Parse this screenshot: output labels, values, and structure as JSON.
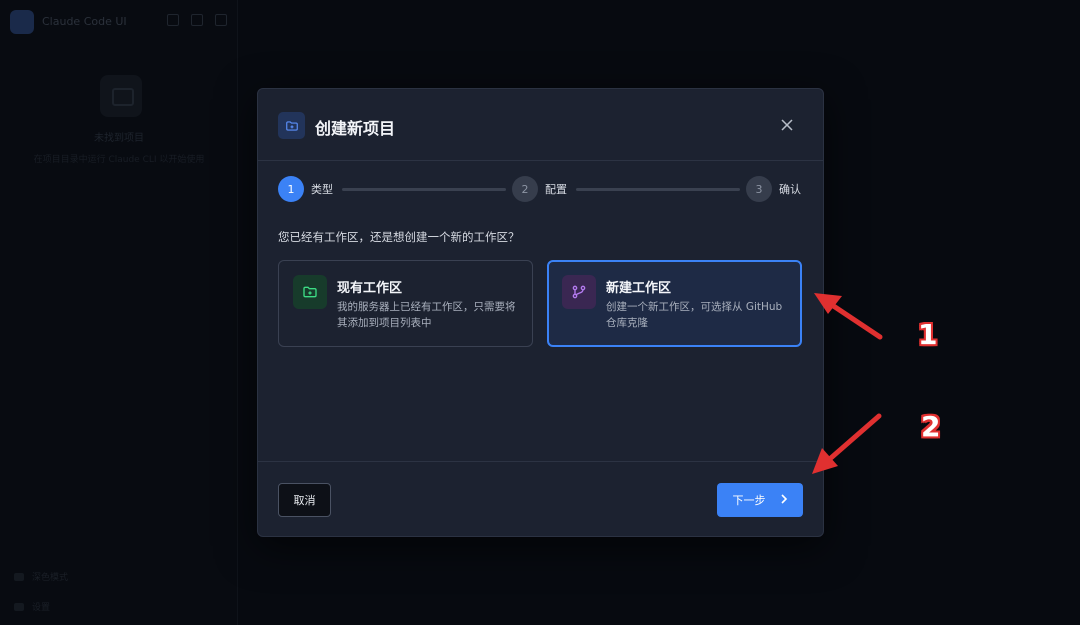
{
  "background_app": {
    "title": "Claude Code UI",
    "empty_title": "未找到项目",
    "empty_desc": "在项目目录中运行 Claude CLI 以开始使用",
    "footer_items": [
      "深色模式",
      "设置"
    ]
  },
  "modal": {
    "title": "创建新项目",
    "steps": [
      {
        "number": "1",
        "label": "类型",
        "state": "active"
      },
      {
        "number": "2",
        "label": "配置",
        "state": "idle"
      },
      {
        "number": "3",
        "label": "确认",
        "state": "idle"
      }
    ],
    "question": "您已经有工作区，还是想创建一个新的工作区？",
    "options": [
      {
        "title": "现有工作区",
        "desc": "我的服务器上已经有工作区，只需要将其添加到项目列表中",
        "icon": "folder-plus-icon",
        "selected": false
      },
      {
        "title": "新建工作区",
        "desc": "创建一个新工作区，可选择从 GitHub 仓库克隆",
        "icon": "git-branch-icon",
        "selected": true
      }
    ],
    "cancel_label": "取消",
    "next_label": "下一步"
  },
  "annotations": [
    "1",
    "2"
  ],
  "colors": {
    "accent": "#3b82f6",
    "arrow": "#e03030"
  }
}
